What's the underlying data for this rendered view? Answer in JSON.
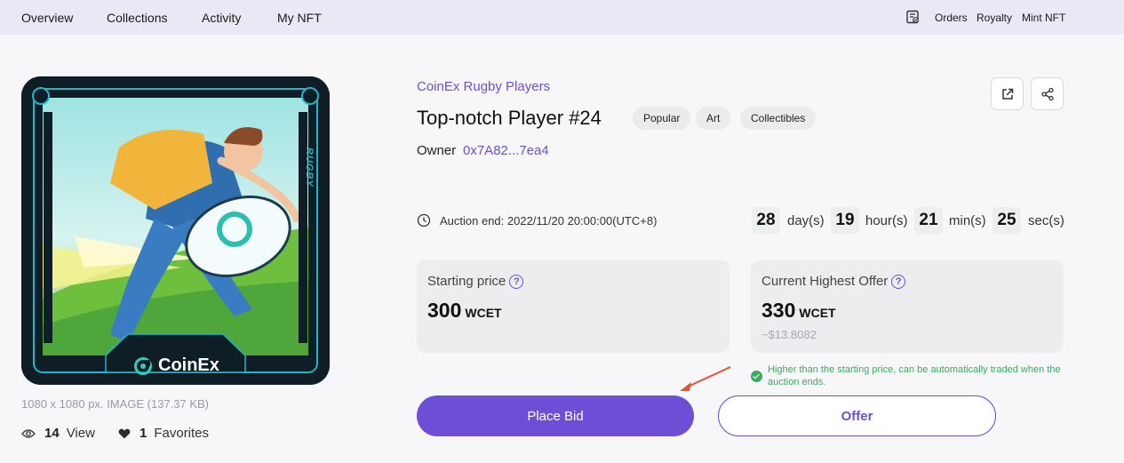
{
  "nav": {
    "items": [
      "Overview",
      "Collections",
      "Activity",
      "My NFT"
    ],
    "right": [
      "Orders",
      "Royalty",
      "Mint NFT"
    ]
  },
  "artwork": {
    "side_label": "RUGBY",
    "brand": "CoinEx",
    "meta": "1080 x 1080 px. IMAGE (137.37 KB)"
  },
  "stats": {
    "views": "14",
    "views_label": "View",
    "favorites": "1",
    "favorites_label": "Favorites"
  },
  "nft": {
    "collection": "CoinEx Rugby Players",
    "title": "Top-notch Player #24",
    "tags": [
      "Popular",
      "Art",
      "Collectibles"
    ],
    "owner_label": "Owner",
    "owner": "0x7A82...7ea4"
  },
  "auction": {
    "end_text": "Auction end: 2022/11/20 20:00:00(UTC+8)",
    "days": "28",
    "days_unit": "day(s)",
    "hours": "19",
    "hours_unit": "hour(s)",
    "mins": "21",
    "mins_unit": "min(s)",
    "secs": "25",
    "secs_unit": "sec(s)"
  },
  "starting": {
    "label": "Starting price",
    "value": "300",
    "unit": "WCET"
  },
  "highest": {
    "label": "Current Highest Offer",
    "value": "330",
    "unit": "WCET",
    "usd": "~$13.8082"
  },
  "note": "Higher than the starting price, can be automatically traded when the auction ends.",
  "buttons": {
    "bid": "Place Bid",
    "offer": "Offer"
  },
  "colors": {
    "accent": "#6c4fd6",
    "success": "#3aaa5e",
    "nav_bg": "#e9e8f5",
    "annotation_arrow": "#e8502e"
  }
}
